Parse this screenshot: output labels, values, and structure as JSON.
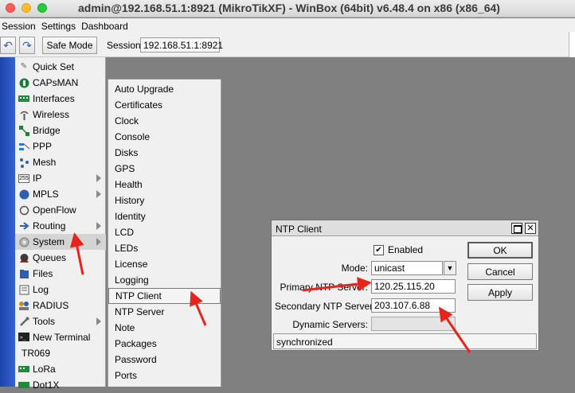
{
  "window": {
    "title": "admin@192.168.51.1:8921 (MikroTikXF) - WinBox (64bit) v6.48.4 on x86 (x86_64)"
  },
  "menubar": {
    "items": [
      "Session",
      "Settings",
      "Dashboard"
    ]
  },
  "toolbar": {
    "safe_mode": "Safe Mode",
    "session_label": "Session:",
    "session_value": "192.168.51.1:8921"
  },
  "sidebar": {
    "items": [
      {
        "label": "Quick Set",
        "icon": "quick-set-icon",
        "submenu": false
      },
      {
        "label": "CAPsMAN",
        "icon": "capsman-icon",
        "submenu": false
      },
      {
        "label": "Interfaces",
        "icon": "interfaces-icon",
        "submenu": false
      },
      {
        "label": "Wireless",
        "icon": "wireless-icon",
        "submenu": false
      },
      {
        "label": "Bridge",
        "icon": "bridge-icon",
        "submenu": false
      },
      {
        "label": "PPP",
        "icon": "ppp-icon",
        "submenu": false
      },
      {
        "label": "Mesh",
        "icon": "mesh-icon",
        "submenu": false
      },
      {
        "label": "IP",
        "icon": "ip-icon",
        "submenu": true
      },
      {
        "label": "MPLS",
        "icon": "mpls-icon",
        "submenu": true
      },
      {
        "label": "OpenFlow",
        "icon": "openflow-icon",
        "submenu": false
      },
      {
        "label": "Routing",
        "icon": "routing-icon",
        "submenu": true
      },
      {
        "label": "System",
        "icon": "system-icon",
        "submenu": true,
        "selected": true
      },
      {
        "label": "Queues",
        "icon": "queues-icon",
        "submenu": false
      },
      {
        "label": "Files",
        "icon": "files-icon",
        "submenu": false
      },
      {
        "label": "Log",
        "icon": "log-icon",
        "submenu": false
      },
      {
        "label": "RADIUS",
        "icon": "radius-icon",
        "submenu": false
      },
      {
        "label": "Tools",
        "icon": "tools-icon",
        "submenu": true
      },
      {
        "label": "New Terminal",
        "icon": "terminal-icon",
        "submenu": false
      },
      {
        "label": "TR069",
        "icon": "",
        "submenu": false
      },
      {
        "label": "LoRa",
        "icon": "lora-icon",
        "submenu": false
      },
      {
        "label": "Dot1X",
        "icon": "dot1x-icon",
        "submenu": false
      }
    ],
    "icon_glyphs": {
      "IP": "255",
      "TR069": ""
    }
  },
  "system_submenu": {
    "items": [
      "Auto Upgrade",
      "Certificates",
      "Clock",
      "Console",
      "Disks",
      "GPS",
      "Health",
      "History",
      "Identity",
      "LCD",
      "LEDs",
      "License",
      "Logging",
      "NTP Client",
      "NTP Server",
      "Note",
      "Packages",
      "Password",
      "Ports"
    ],
    "selected": "NTP Client"
  },
  "ntp_dialog": {
    "title": "NTP Client",
    "enabled_label": "Enabled",
    "enabled_checked": true,
    "mode_label": "Mode:",
    "mode_value": "unicast",
    "primary_label": "Primary NTP Server:",
    "primary_value": "120.25.115.20",
    "secondary_label": "Secondary NTP Server:",
    "secondary_value": "203.107.6.88",
    "dynamic_label": "Dynamic Servers:",
    "dynamic_value": "",
    "ok_label": "OK",
    "cancel_label": "Cancel",
    "apply_label": "Apply",
    "status": "synchronized"
  },
  "colors": {
    "annotation_arrow": "#e8231b",
    "strip_blue": "#2a55c4"
  }
}
